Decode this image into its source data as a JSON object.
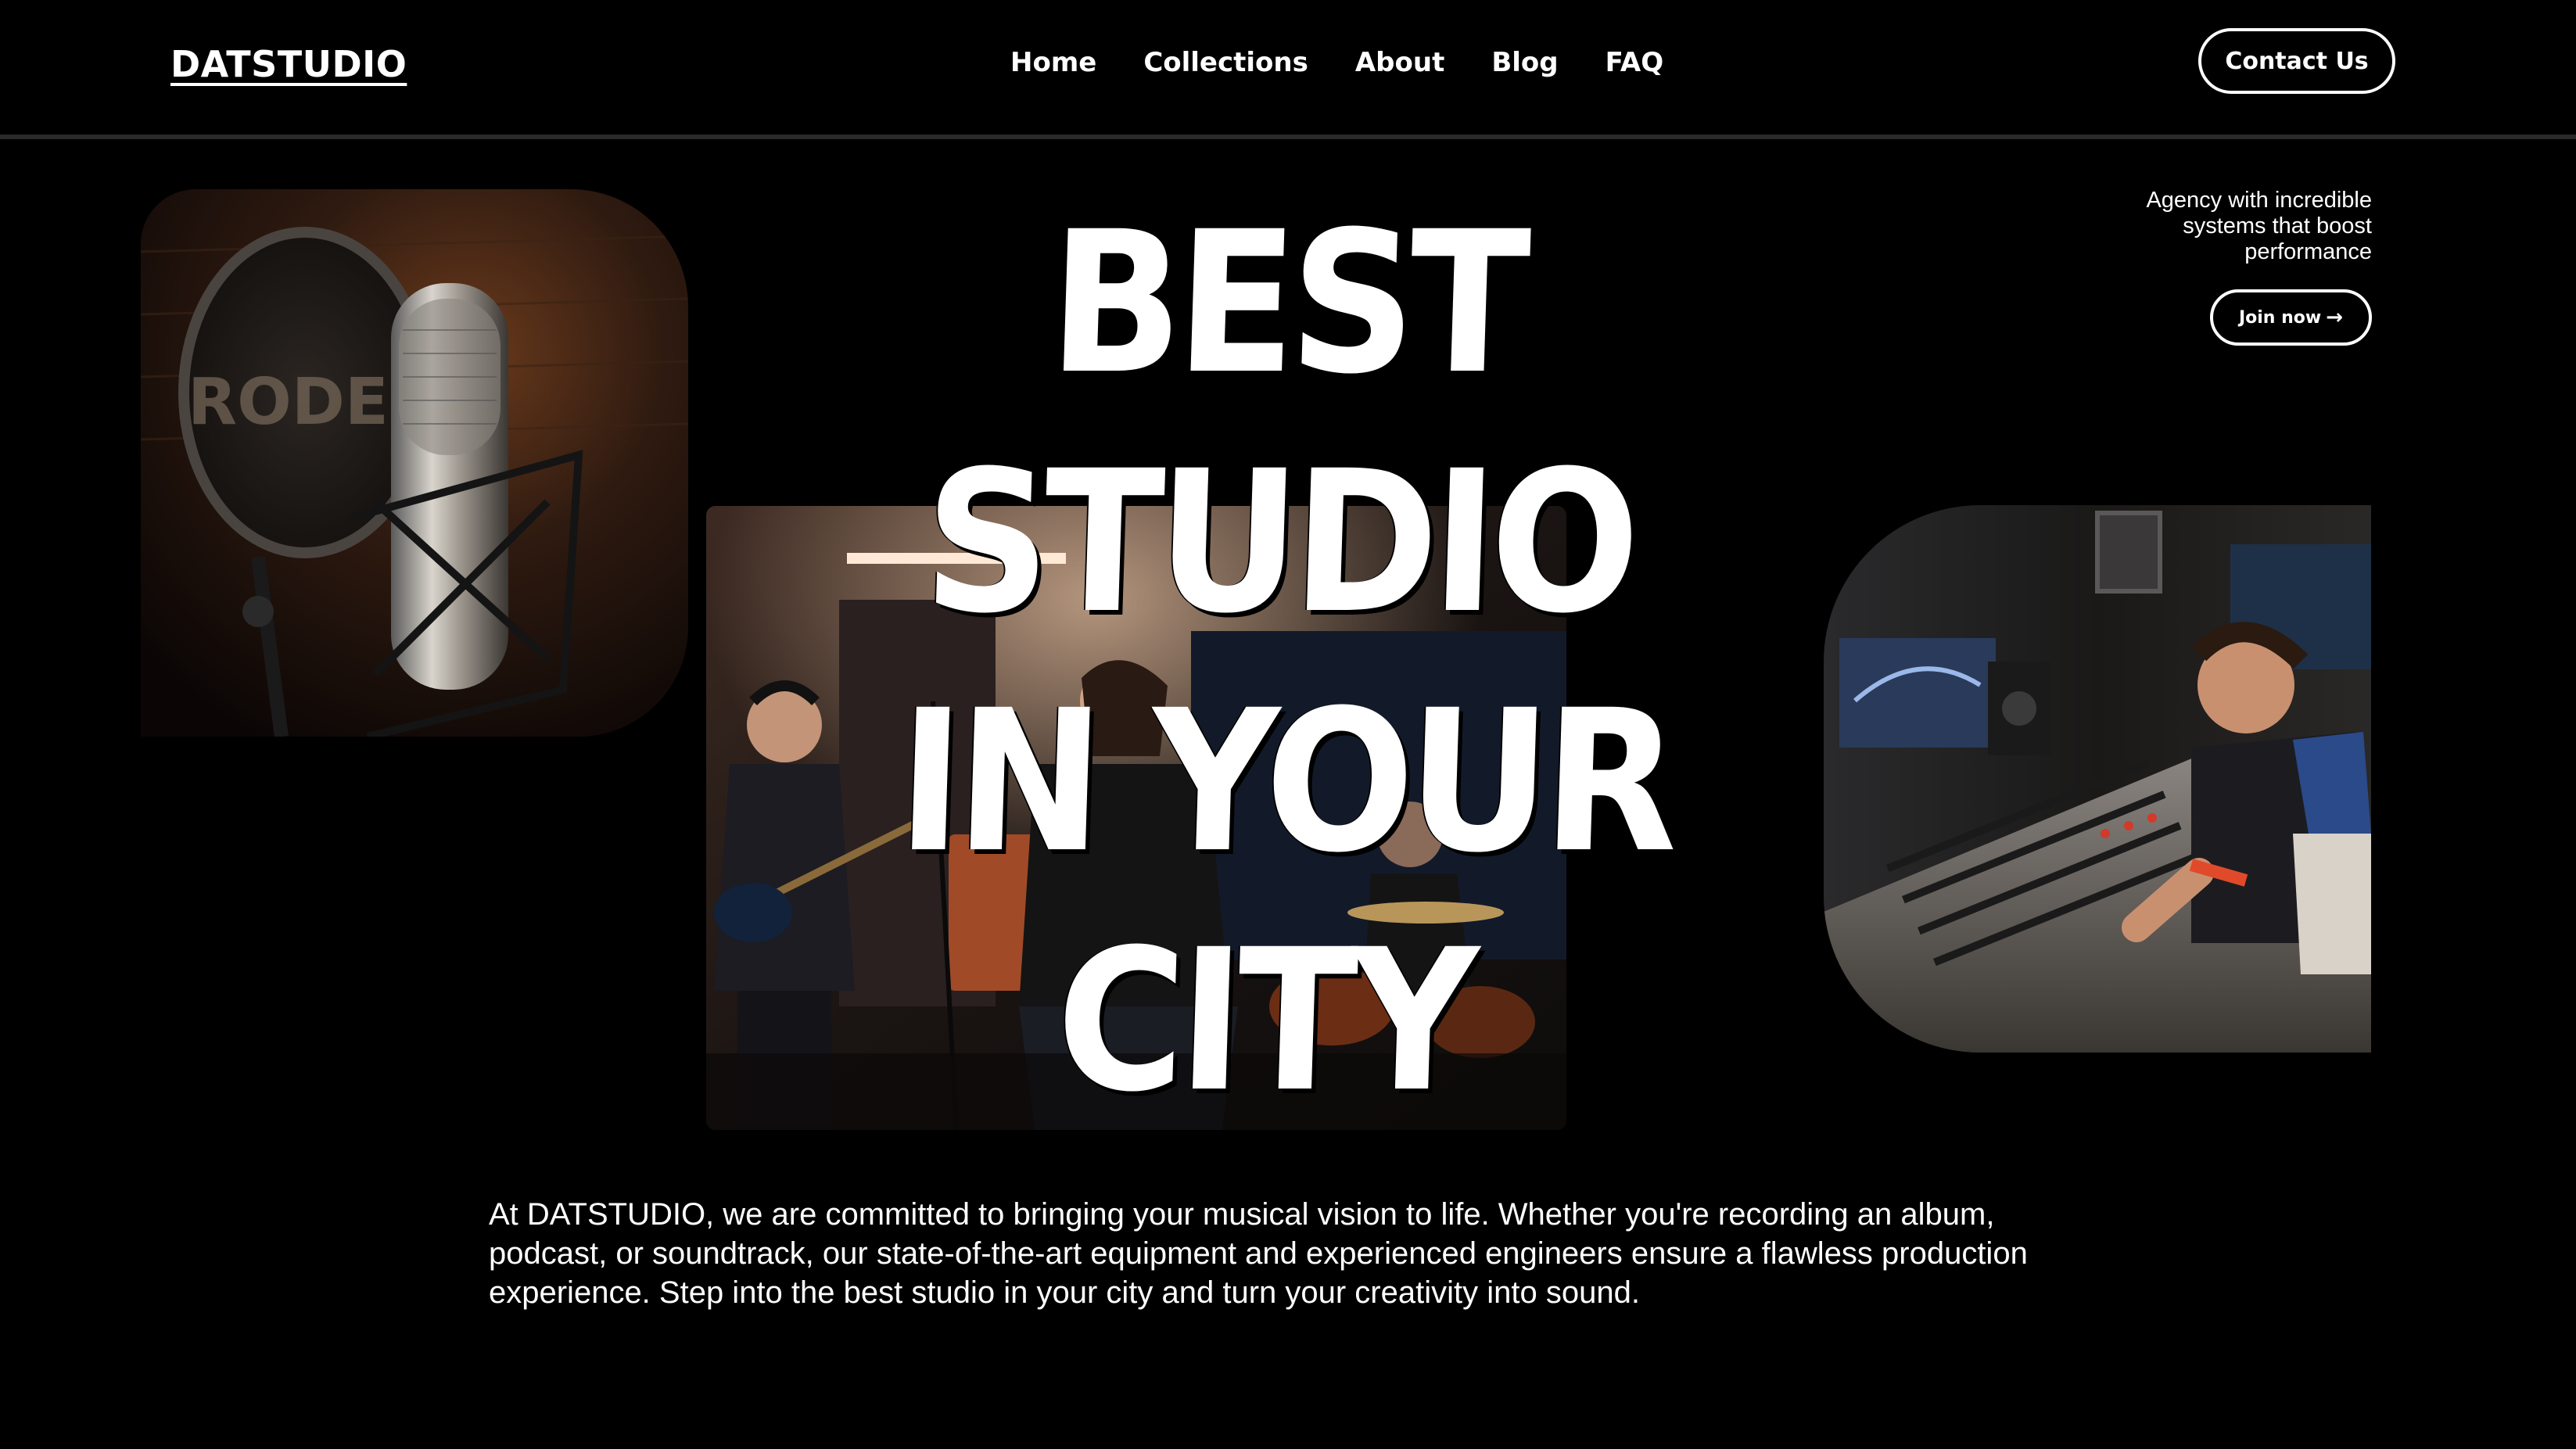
{
  "header": {
    "logo": "DATSTUDIO",
    "nav": [
      "Home",
      "Collections",
      "About",
      "Blog",
      "FAQ"
    ],
    "contact_label": "Contact Us"
  },
  "hero": {
    "lines": [
      "BEST",
      "STUDIO",
      "IN YOUR",
      "CITY"
    ]
  },
  "promo": {
    "text": "Agency with incredible systems that boost performance",
    "join_label": "Join now",
    "join_icon": "arrow-right-icon"
  },
  "main": {
    "description": "At DATSTUDIO, we are committed to bringing your musical vision to life. Whether you're recording an album, podcast, or soundtrack, our state-of-the-art equipment and experienced engineers ensure a flawless production experience. Step into the best studio in your city and turn your creativity into sound."
  },
  "images": {
    "mic_brand": "RODE"
  },
  "colors": {
    "background": "#000000",
    "text": "#ffffff",
    "warm_accent": "#c97a3a"
  }
}
